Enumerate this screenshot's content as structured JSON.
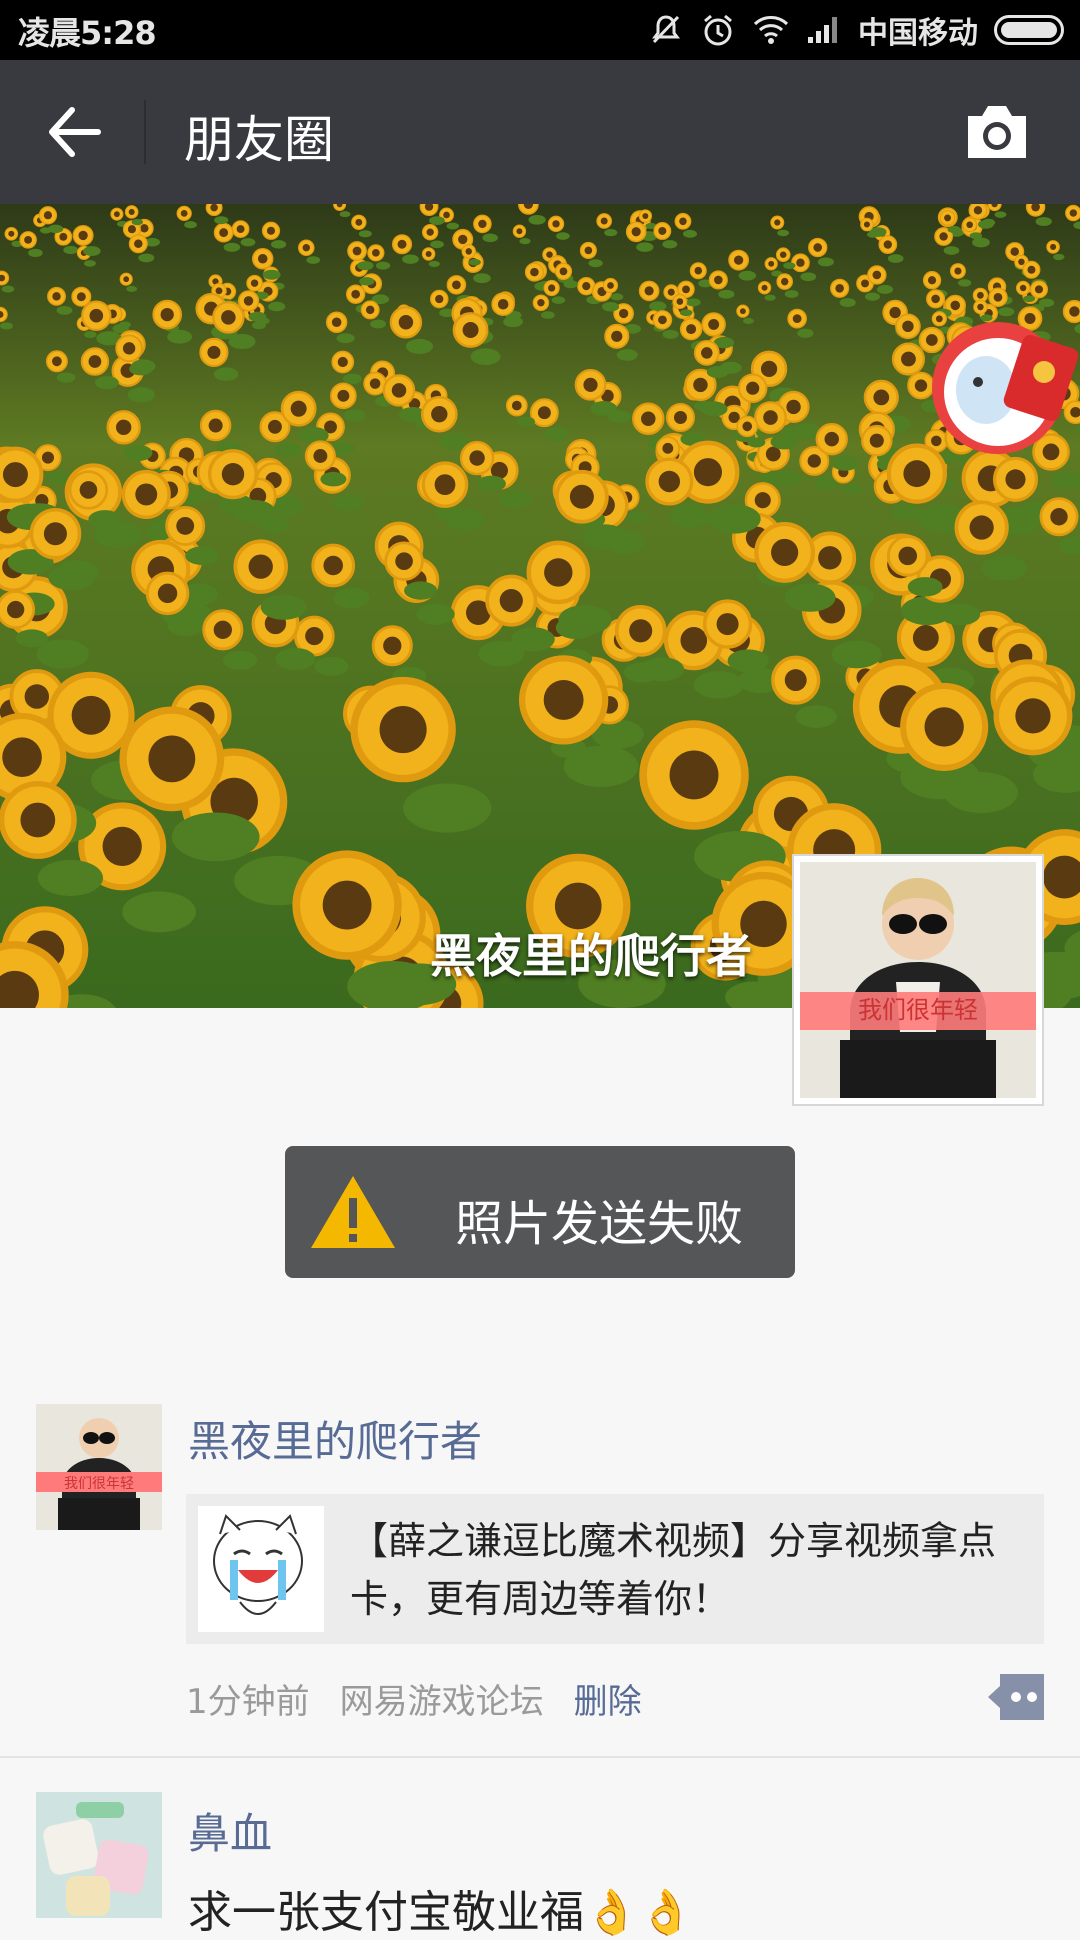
{
  "status_bar": {
    "time": "凌晨5:28",
    "carrier": "中国移动",
    "icons": [
      "mute-icon",
      "alarm-icon",
      "wifi-icon",
      "signal-icon",
      "battery-icon"
    ]
  },
  "header": {
    "title": "朋友圈",
    "back_icon": "arrow-left-icon",
    "camera_icon": "camera-icon"
  },
  "cover": {
    "owner_name": "黑夜里的爬行者",
    "profile_caption": "我们很年轻"
  },
  "toast": {
    "text": "照片发送失败",
    "icon": "warning-icon"
  },
  "posts": [
    {
      "author": "黑夜里的爬行者",
      "avatar_caption": "我们很年轻",
      "share_text": "【薛之谦逗比魔术视频】分享视频拿点卡，更有周边等着你！",
      "time": "1分钟前",
      "source": "网易游戏论坛",
      "delete_label": "删除"
    },
    {
      "author": "鼻血",
      "text": "求一张支付宝敬业福👌👌"
    }
  ],
  "colors": {
    "title_bar": "#393a3f",
    "link_blue": "#576b95",
    "toast_bg": "#555658",
    "warning_yellow": "#f5b800"
  }
}
